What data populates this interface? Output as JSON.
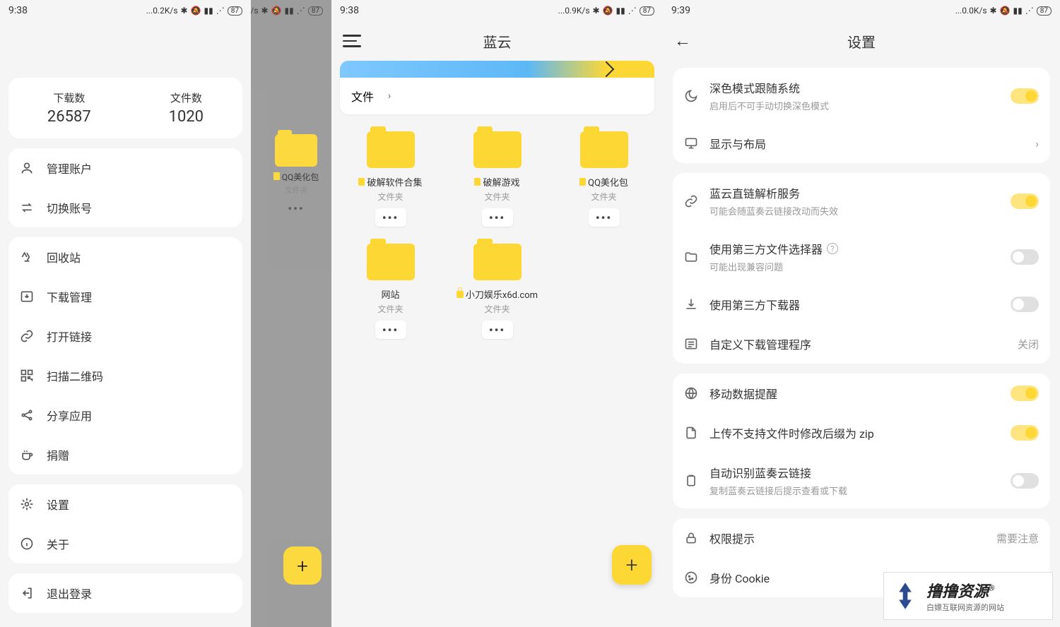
{
  "screen1": {
    "statusbar": {
      "time": "9:38",
      "speed": "0.2K/s",
      "battery": "87"
    },
    "stats": {
      "downloads_label": "下载数",
      "downloads_val": "26587",
      "files_label": "文件数",
      "files_val": "1020"
    },
    "group1": [
      {
        "label": "管理账户"
      },
      {
        "label": "切换账号"
      }
    ],
    "group2": [
      {
        "label": "回收站"
      },
      {
        "label": "下载管理"
      },
      {
        "label": "打开链接"
      },
      {
        "label": "扫描二维码"
      },
      {
        "label": "分享应用"
      },
      {
        "label": "捐赠"
      }
    ],
    "group3": [
      {
        "label": "设置"
      },
      {
        "label": "关于"
      }
    ],
    "group4": [
      {
        "label": "退出登录"
      }
    ],
    "bg_folder": {
      "name": "QQ美化包",
      "sub": "文件夹"
    }
  },
  "screen2": {
    "statusbar": {
      "time": "9:38",
      "speed": "0.9K/s",
      "battery": "87"
    },
    "title": "蓝云",
    "breadcrumb": "文件",
    "folders": [
      {
        "name": "破解软件合集",
        "sub": "文件夹",
        "badge": "doc"
      },
      {
        "name": "破解游戏",
        "sub": "文件夹",
        "badge": "doc"
      },
      {
        "name": "QQ美化包",
        "sub": "文件夹",
        "badge": "doc"
      },
      {
        "name": "网站",
        "sub": "文件夹",
        "badge": null
      },
      {
        "name": "小刀娱乐x6d.com",
        "sub": "文件夹",
        "badge": "lock"
      }
    ]
  },
  "screen3": {
    "statusbar": {
      "time": "9:39",
      "speed": "0.0K/s",
      "battery": "87"
    },
    "title": "设置",
    "g1": [
      {
        "title": "深色模式跟随系统",
        "sub": "启用后不可手动切换深色模式",
        "toggle": true
      },
      {
        "title": "显示与布局",
        "chevron": true
      }
    ],
    "g2": [
      {
        "title": "蓝云直链解析服务",
        "sub": "可能会随蓝奏云链接改动而失效",
        "toggle": true
      },
      {
        "title": "使用第三方文件选择器",
        "sub": "可能出现兼容问题",
        "help": true,
        "toggle": false
      },
      {
        "title": "使用第三方下载器",
        "toggle": false
      },
      {
        "title": "自定义下载管理程序",
        "value": "关闭"
      }
    ],
    "g3": [
      {
        "title": "移动数据提醒",
        "toggle": true
      },
      {
        "title": "上传不支持文件时修改后缀为 zip",
        "toggle": true
      },
      {
        "title": "自动识别蓝奏云链接",
        "sub": "复制蓝奏云链接后提示查看或下载",
        "toggle": false
      }
    ],
    "g4": [
      {
        "title": "权限提示",
        "value": "需要注意"
      },
      {
        "title": "身份 Cookie"
      }
    ],
    "watermark": {
      "big": "撸撸资源",
      "sm": "白嫖互联网资源的网站",
      "reg": "®"
    }
  }
}
